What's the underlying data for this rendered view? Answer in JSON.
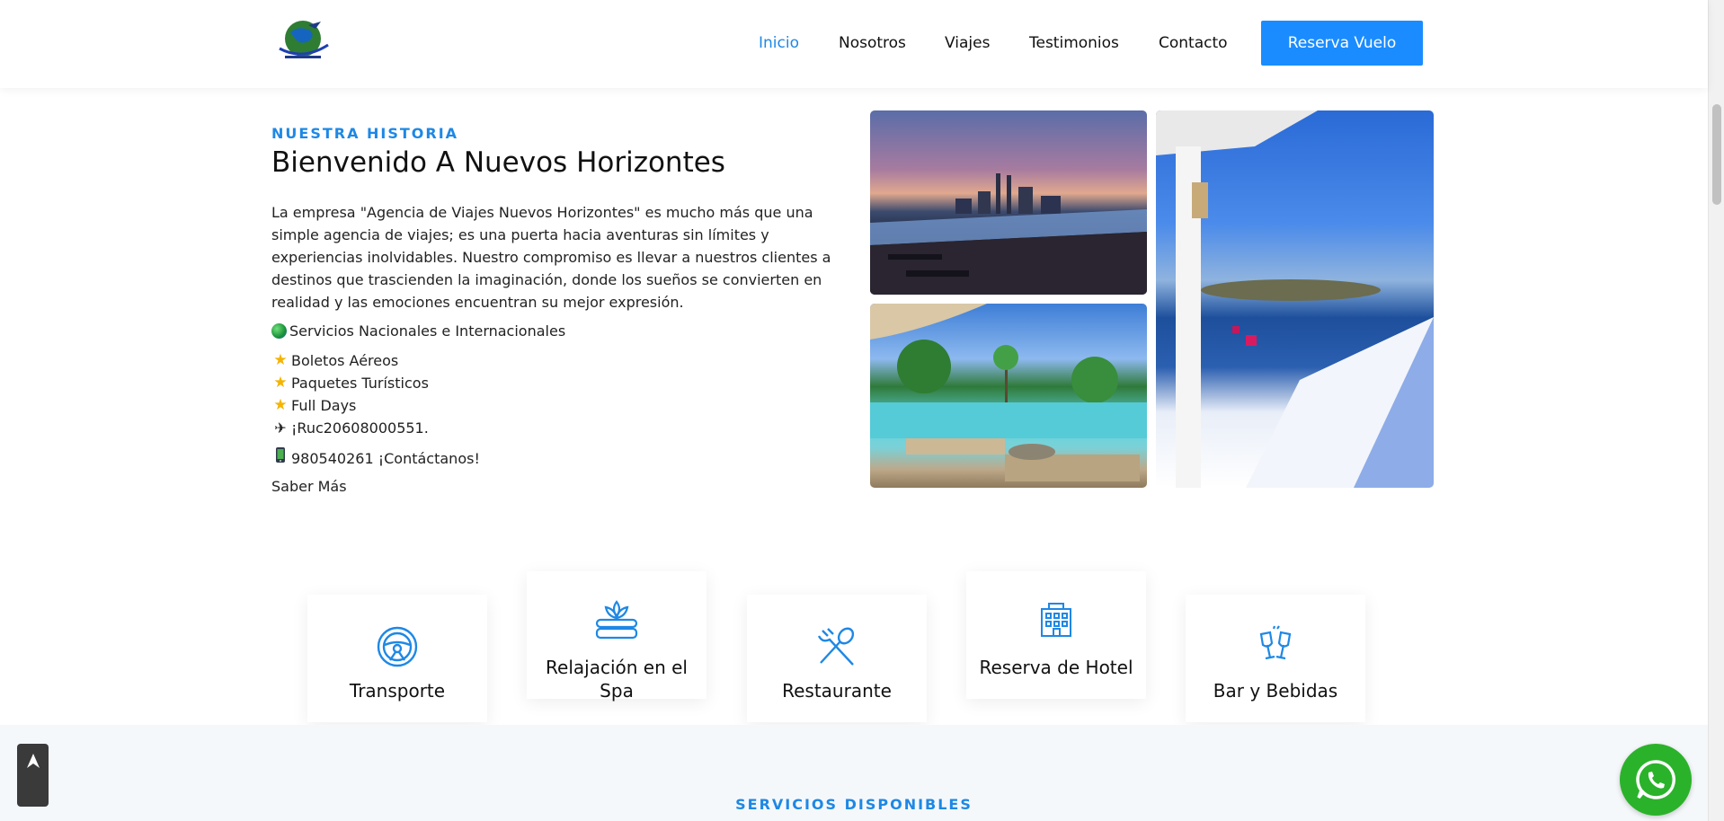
{
  "header": {
    "logo_name": "agencia-logo",
    "nav": [
      "Inicio",
      "Nosotros",
      "Viajes",
      "Testimonios",
      "Contacto"
    ],
    "active_index": 0,
    "cta_label": "Reserva Vuelo"
  },
  "about": {
    "eyebrow": "NUESTRA HISTORIA",
    "title": "Bienvenido A Nuevos Horizontes",
    "description": "La empresa \"Agencia de Viajes Nuevos Horizontes\" es mucho más que una simple agencia de viajes; es una puerta hacia aventuras sin límites y experiencias inolvidables. Nuestro compromiso es llevar a nuestros clientes a destinos que trascienden la imaginación, donde los sueños se convierten en realidad y las emociones encuentran su mejor expresión.",
    "features": [
      {
        "icon": "globe-icon",
        "text": "Servicios Nacionales e Internacionales"
      },
      {
        "icon": "star-icon",
        "text": "Boletos Aéreos"
      },
      {
        "icon": "star-icon",
        "text": "Paquetes Turísticos"
      },
      {
        "icon": "star-icon",
        "text": "Full Days"
      },
      {
        "icon": "airplane-icon",
        "text": "¡Ruc20608000551."
      },
      {
        "icon": "mobile-phone-icon",
        "text": " 980540261 ¡Contáctanos!"
      }
    ],
    "more_link": "Saber Más"
  },
  "gallery": [
    "city-infinity-pool-photo",
    "tropical-resort-pool-photo",
    "santorini-terrace-photo"
  ],
  "services": [
    {
      "icon": "steering-wheel-icon",
      "label": "Transporte"
    },
    {
      "icon": "spa-lotus-icon",
      "label": "Relajación en el Spa"
    },
    {
      "icon": "fork-spoon-icon",
      "label": "Restaurante"
    },
    {
      "icon": "hotel-building-icon",
      "label": "Reserva de Hotel"
    },
    {
      "icon": "cheers-glasses-icon",
      "label": "Bar y Bebidas"
    }
  ],
  "band": {
    "title": "SERVICIOS DISPONIBLES"
  },
  "floating": {
    "scroll_top": "arrow-up-icon",
    "whatsapp": "whatsapp-icon"
  },
  "colors": {
    "accent": "#1E88E5",
    "button": "#1A8CFF",
    "whatsapp": "#2BB22B"
  }
}
